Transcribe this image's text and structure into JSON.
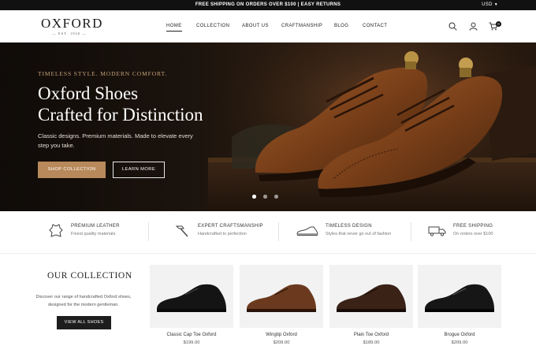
{
  "topbar": {
    "message": "FREE SHIPPING ON ORDERS OVER $100 | EASY RETURNS",
    "currency": "USD"
  },
  "logo": {
    "name": "OXFORD",
    "est": "EST. 1920"
  },
  "nav": {
    "items": [
      "HOME",
      "COLLECTION",
      "ABOUT US",
      "CRAFTMANSHIP",
      "BLOG",
      "CONTACT"
    ],
    "cart_count": "0"
  },
  "hero": {
    "tagline": "TIMELESS STYLE. MODERN COMFORT.",
    "title_line1": "Oxford Shoes",
    "title_line2": "Crafted for Distinction",
    "subtitle": "Classic designs. Premium materials. Made to elevate every step you take.",
    "primary_button": "SHOP COLLECTION",
    "secondary_button": "LEARN MORE",
    "slides": 3,
    "active_slide": 1
  },
  "features": [
    {
      "title": "PREMIUM LEATHER",
      "desc": "Finest quality materials",
      "icon": "leather-hide-icon"
    },
    {
      "title": "EXPERT CRAFTSMANSHIP",
      "desc": "Handcrafted to perfection",
      "icon": "hammer-icon"
    },
    {
      "title": "TIMELESS DESIGN",
      "desc": "Styles that never go out of fashion",
      "icon": "shoe-icon"
    },
    {
      "title": "FREE SHIPPING",
      "desc": "On orders over $100",
      "icon": "truck-icon"
    }
  ],
  "collection": {
    "title": "OUR COLLECTION",
    "description": "Discover our range of handcrafted Oxford shoes, designed for the modern gentleman.",
    "button": "VIEW ALL SHOES"
  },
  "products": [
    {
      "name": "Classic Cap Toe Oxford",
      "price": "$199.00",
      "color": "#141414"
    },
    {
      "name": "Wingtip Oxford",
      "price": "$209.00",
      "color": "#6b3a1e"
    },
    {
      "name": "Plain Toe Oxford",
      "price": "$189.00",
      "color": "#3a2217"
    },
    {
      "name": "Brogue Oxford",
      "price": "$209.00",
      "color": "#161616"
    }
  ],
  "colors": {
    "accent": "#b8895a",
    "topbar": "#111111",
    "hero_bg": "#1b130d",
    "dark_button": "#1d1d1d"
  }
}
